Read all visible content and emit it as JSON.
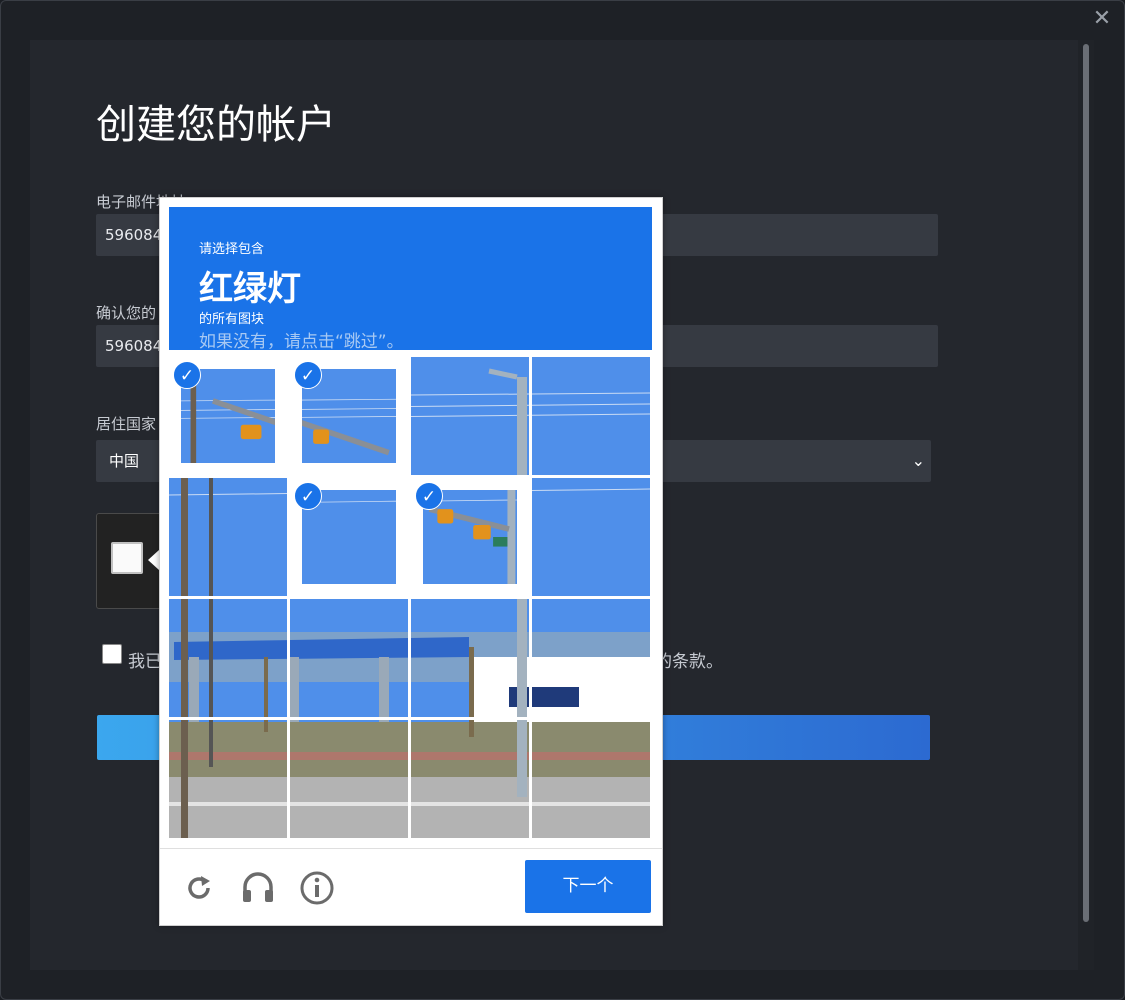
{
  "form": {
    "title": "创建您的帐户",
    "email_label": "电子邮件地址",
    "email_value": "596084",
    "confirm_label": "确认您的",
    "confirm_value": "596084",
    "country_label": "居住国家",
    "country_value": "中国",
    "terms_left": "我已",
    "terms_right": "的条款。"
  },
  "captcha": {
    "prompt_pre": "请选择包含",
    "prompt_target": "红绿灯",
    "prompt_post": "的所有图块",
    "prompt_skip": "如果没有，请点击“跳过”。",
    "selected_tiles": [
      0,
      1,
      5,
      6
    ],
    "next_label": "下一个",
    "footer_icons": [
      "reload-icon",
      "audio-icon",
      "info-icon"
    ]
  },
  "colors": {
    "accent": "#1a73e8",
    "submit_start": "#3ba7ee",
    "submit_end": "#2c6ad1"
  }
}
